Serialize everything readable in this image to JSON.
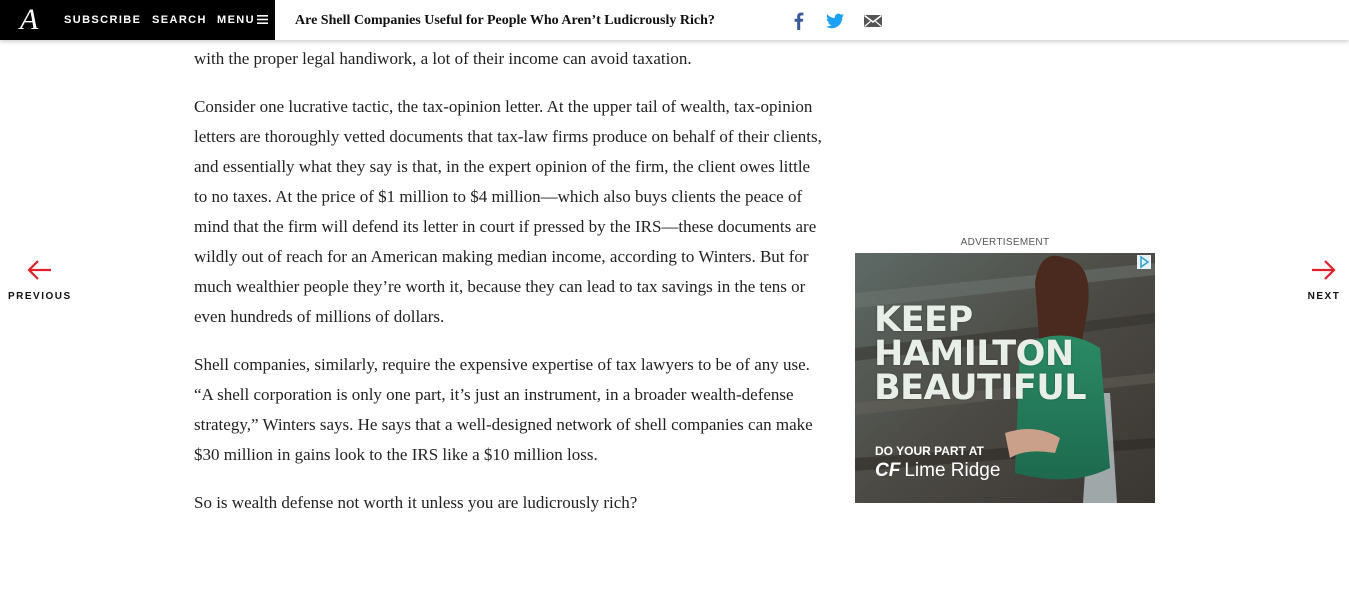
{
  "header": {
    "logo": "A",
    "subscribe": "SUBSCRIBE",
    "search": "SEARCH",
    "menu": "MENU",
    "headline": "Are Shell Companies Useful for People Who Aren’t Ludicrously Rich?"
  },
  "article": {
    "partial_line": "with the proper legal handiwork, a lot of their income can avoid taxation.",
    "paragraphs": [
      "Consider one lucrative tactic, the tax-opinion letter. At the upper tail of wealth, tax-opinion letters are thoroughly vetted documents that tax-law firms produce on behalf of their clients, and essentially what they say is that, in the expert opinion of the firm, the client owes little to no taxes. At the price of $1 million to $4 million—which also buys clients the peace of mind that the firm will defend its letter in court if pressed by the IRS—these documents are wildly out of reach for an American making median income, according to Winters. But for much wealthier people they’re worth it, because they can lead to tax savings in the tens or even hundreds of millions of dollars.",
      "Shell companies, similarly, require the expensive expertise of tax lawyers to be of any use. “A shell corporation is only one part, it’s just an instrument, in a broader wealth-defense strategy,” Winters says. He says that a well-designed network of shell companies can make $30 million in gains look to the IRS like a $10 million loss.",
      "So is wealth defense not worth it unless you are ludicrously rich?"
    ]
  },
  "nav": {
    "previous": "PREVIOUS",
    "next": "NEXT"
  },
  "ad": {
    "label": "ADVERTISEMENT",
    "line1": "KEEP",
    "line2": "HAMILTON",
    "line3": "BEAUTIFUL",
    "sub": "DO YOUR PART AT",
    "brand_mark": "CF",
    "brand_name": "Lime Ridge"
  },
  "colors": {
    "accent_red": "#e0202a",
    "brand_black": "#000000"
  }
}
